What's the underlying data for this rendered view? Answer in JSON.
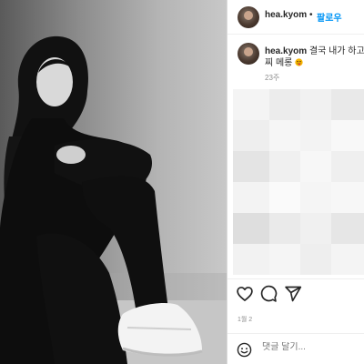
{
  "post": {
    "photo_icon": "photo-black-white-portrait"
  },
  "header": {
    "username": "hea.kyom",
    "separator": "•",
    "follow_label": "팔로우"
  },
  "caption": {
    "username": "hea.kyom",
    "text": "결국 내가 하고",
    "text_line2": "찌 메롱",
    "emoji_icon": "stuck-out-tongue-emoji",
    "time": "23주"
  },
  "actions": {
    "like_icon": "heart-icon",
    "comment_icon": "comment-icon",
    "share_icon": "send-icon"
  },
  "date": "1월 2",
  "comment_bar": {
    "emoji_icon": "smiley-icon",
    "placeholder": "댓글 달기..."
  },
  "colors": {
    "follow_blue": "#0095f6",
    "muted_gray": "#8e8e8e",
    "text": "#262626",
    "divider": "#dbdbdb"
  }
}
